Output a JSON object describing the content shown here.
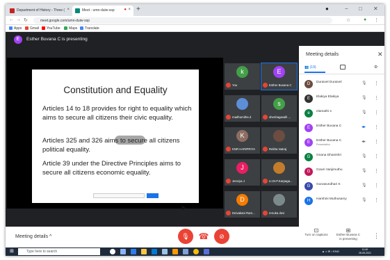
{
  "browser": {
    "tabs": [
      {
        "label": "Department of History - Three ("
      },
      {
        "label": "Meet - umn-duiw-ssp"
      }
    ],
    "url": "meet.google.com/umn-duiw-ssp",
    "bookmarks": [
      "Apps",
      "Gmail",
      "YouTube",
      "Maps",
      "Translate"
    ]
  },
  "meet": {
    "presenting_text": "Esther Buvana C is presenting",
    "presenter_initial": "E"
  },
  "slide": {
    "title": "Constitution and Equality",
    "paragraphs": [
      "Articles 14 to 18 provides for right to equality which aims to secure all citizens their civic equality.",
      "Articles 325 and 326 aims to secure all citizens political equality.",
      "Article 39 under the Directive Principles aims to secure all citizens economic equality."
    ]
  },
  "tiles": [
    {
      "name": "You",
      "initial": "k",
      "color": "#43a047"
    },
    {
      "name": "Esther Buvana C",
      "initial": "E",
      "color": "#a142f4"
    },
    {
      "name": "madhumitha d",
      "initial": "",
      "color": "#5c8fd6"
    },
    {
      "name": "shenbagavalli ...",
      "initial": "s",
      "color": "#43a047"
    },
    {
      "name": "KNR HARIPRIYA",
      "initial": "K",
      "color": "#8d6e63"
    },
    {
      "name": "Rekha Natraj",
      "initial": "",
      "color": "#6d4c41"
    },
    {
      "name": "Jenciya J",
      "initial": "J",
      "color": "#e91e63"
    },
    {
      "name": "Lt.Dr.P.Karpaga...",
      "initial": "",
      "color": "#c27c2c"
    },
    {
      "name": "Deivakani Ram...",
      "initial": "D",
      "color": "#f57c00"
    },
    {
      "name": "renuka devi",
      "initial": "",
      "color": "#7b8a8b"
    }
  ],
  "panel": {
    "title": "Meeting details",
    "people_tab": "(19)",
    "participants": [
      {
        "name": "Duraivel Duraivel",
        "initial": "D",
        "color": "#6d4c41",
        "sub": ""
      },
      {
        "name": "Elakiya Elakiya",
        "initial": "E",
        "color": "#333333",
        "sub": ""
      },
      {
        "name": "elamathi s",
        "initial": "e",
        "color": "#0b8043",
        "sub": ""
      },
      {
        "name": "Esther Buvana C",
        "initial": "E",
        "color": "#a142f4",
        "sub": ""
      },
      {
        "name": "Esther Buvana C",
        "initial": "E",
        "color": "#a142f4",
        "sub": "Presentation"
      },
      {
        "name": "Gnana Dhanishri",
        "initial": "G",
        "color": "#0b8043",
        "sub": ""
      },
      {
        "name": "Gowri Vanjimuthu",
        "initial": "G",
        "color": "#c2185b",
        "sub": ""
      },
      {
        "name": "Gunasundhari K",
        "initial": "G",
        "color": "#3949ab",
        "sub": ""
      },
      {
        "name": "Harshini Muthusamy",
        "initial": "H",
        "color": "#1a73e8",
        "sub": ""
      }
    ]
  },
  "bottom": {
    "meeting_details": "Meeting details",
    "captions": "Turn on captions",
    "present_line1": "Esther Buvana C",
    "present_line2": "is presenting"
  },
  "taskbar": {
    "search": "Type here to search",
    "time": "11:40",
    "date": "28-05-2021",
    "tray": "ENG"
  }
}
